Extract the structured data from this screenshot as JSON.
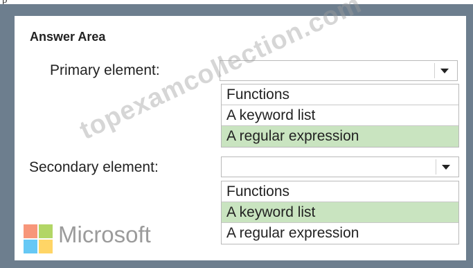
{
  "page_label": "p",
  "answer_area": {
    "title": "Answer Area",
    "primary": {
      "label": "Primary element:",
      "options": [
        "Functions",
        "A keyword list",
        "A regular expression"
      ],
      "selected": "A regular expression"
    },
    "secondary": {
      "label": "Secondary element:",
      "options": [
        "Functions",
        "A keyword list",
        "A regular expression"
      ],
      "selected": "A keyword list"
    }
  },
  "watermark": "topexamcollection.com",
  "brand": {
    "name": "Microsoft",
    "colors": {
      "red": "#f25022",
      "green": "#7fba00",
      "blue": "#00a4ef",
      "yellow": "#ffb900"
    }
  },
  "colors": {
    "frame": "#6d7e8e",
    "selected_option": "#c9e4c0"
  },
  "icons": [
    "chevron-down-icon",
    "microsoft-logo-icon"
  ]
}
